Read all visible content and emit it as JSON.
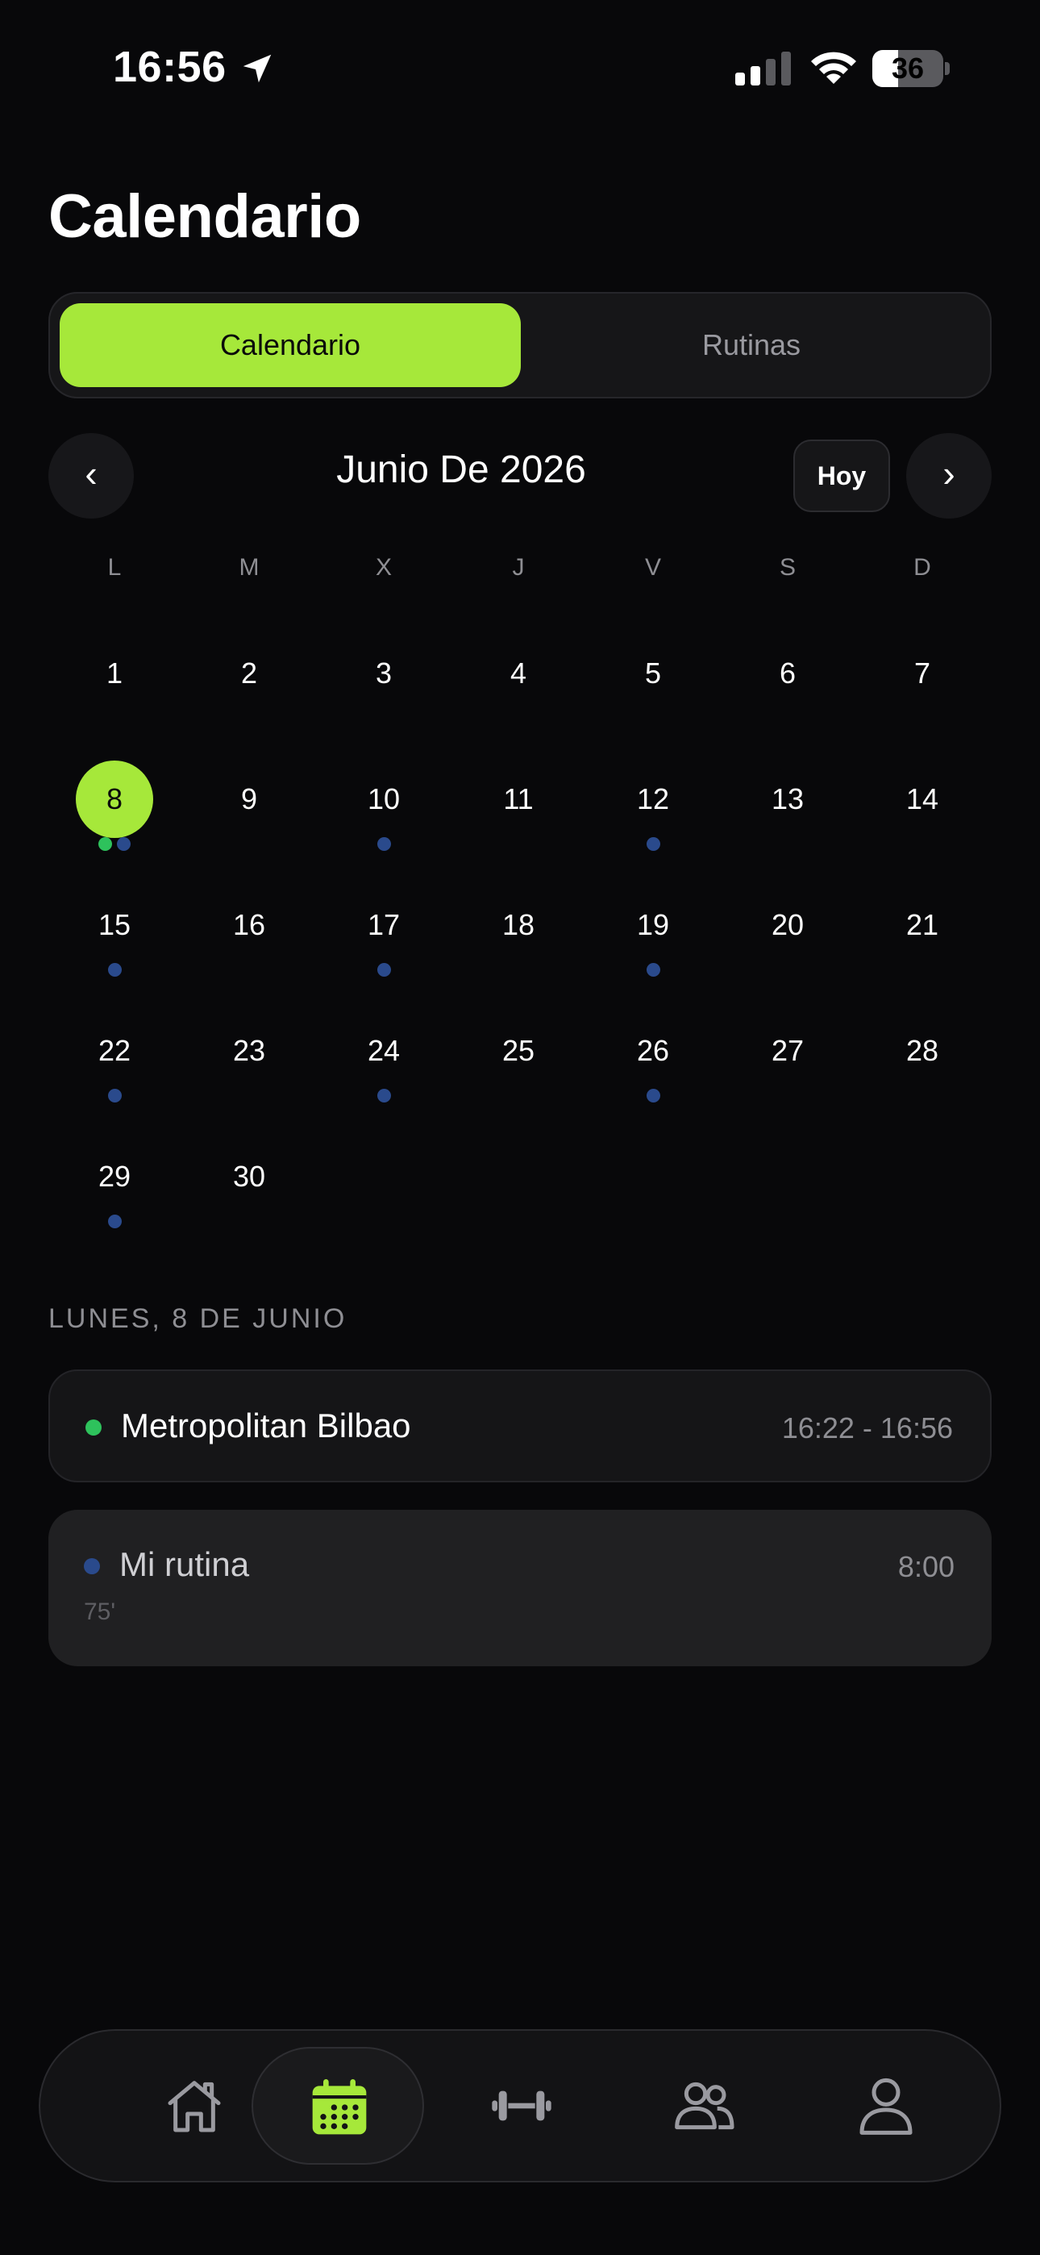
{
  "status_bar": {
    "time": "16:56",
    "battery_level": "36",
    "battery_fraction": 0.36
  },
  "title": "Calendario",
  "segments": [
    {
      "label": "Calendario",
      "active": true
    },
    {
      "label": "Rutinas",
      "active": false
    }
  ],
  "month_nav": {
    "prev_icon": "chevron-left-icon",
    "prev_glyph": "‹",
    "month_label": "Junio De 2026",
    "today_label": "Hoy",
    "next_icon": "chevron-right-icon",
    "next_glyph": "›"
  },
  "weekdays": [
    "L",
    "M",
    "X",
    "J",
    "V",
    "S",
    "D"
  ],
  "days": [
    {
      "num": "1",
      "dots": []
    },
    {
      "num": "2",
      "dots": []
    },
    {
      "num": "3",
      "dots": []
    },
    {
      "num": "4",
      "dots": []
    },
    {
      "num": "5",
      "dots": []
    },
    {
      "num": "6",
      "dots": []
    },
    {
      "num": "7",
      "dots": []
    },
    {
      "num": "8",
      "dots": [
        "green",
        "blue"
      ],
      "selected": true
    },
    {
      "num": "9",
      "dots": []
    },
    {
      "num": "10",
      "dots": [
        "blue"
      ]
    },
    {
      "num": "11",
      "dots": []
    },
    {
      "num": "12",
      "dots": [
        "blue"
      ]
    },
    {
      "num": "13",
      "dots": []
    },
    {
      "num": "14",
      "dots": []
    },
    {
      "num": "15",
      "dots": [
        "blue"
      ]
    },
    {
      "num": "16",
      "dots": []
    },
    {
      "num": "17",
      "dots": [
        "blue"
      ]
    },
    {
      "num": "18",
      "dots": []
    },
    {
      "num": "19",
      "dots": [
        "blue"
      ]
    },
    {
      "num": "20",
      "dots": []
    },
    {
      "num": "21",
      "dots": []
    },
    {
      "num": "22",
      "dots": [
        "blue"
      ]
    },
    {
      "num": "23",
      "dots": []
    },
    {
      "num": "24",
      "dots": [
        "blue"
      ]
    },
    {
      "num": "25",
      "dots": []
    },
    {
      "num": "26",
      "dots": [
        "blue"
      ]
    },
    {
      "num": "27",
      "dots": []
    },
    {
      "num": "28",
      "dots": []
    },
    {
      "num": "29",
      "dots": [
        "blue"
      ]
    },
    {
      "num": "30",
      "dots": []
    }
  ],
  "selected_date_label": "LUNES, 8 DE JUNIO",
  "events": [
    {
      "title": "Metropolitan Bilbao",
      "time": "16:22 - 16:56",
      "dot_color": "#2ec25c"
    },
    {
      "title": "Mi rutina",
      "time": "8:00",
      "subtitle": "75'",
      "dot_color": "#2a4a8c"
    }
  ],
  "tab_bar": {
    "items": [
      {
        "icon": "home-icon",
        "active": false
      },
      {
        "icon": "calendar-icon",
        "active": true
      },
      {
        "icon": "dumbbell-icon",
        "active": false
      },
      {
        "icon": "people-icon",
        "active": false
      },
      {
        "icon": "profile-icon",
        "active": false
      }
    ]
  },
  "colors": {
    "accent": "#a6e83a",
    "background": "#08080a",
    "dot_green": "#2ec25c",
    "dot_blue": "#2a4a8c",
    "muted_text": "#8e8e93"
  }
}
